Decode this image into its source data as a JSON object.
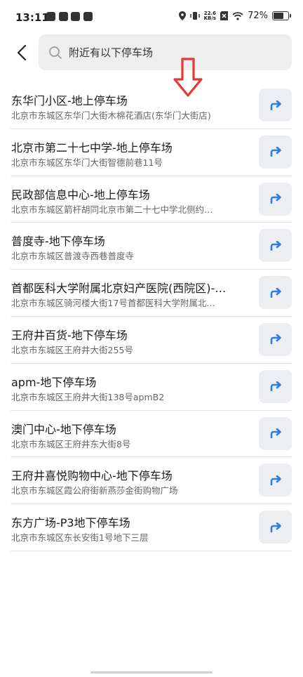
{
  "status_bar": {
    "time": "13:11",
    "net_speed_value": "22.6",
    "net_speed_unit": "KB/s",
    "battery_text": "72%",
    "battery_level": 0.72
  },
  "search": {
    "query": "附近有以下停车场"
  },
  "annotation": {
    "color": "#e53935"
  },
  "accent_color": "#2f7de1",
  "results": [
    {
      "title": "东华门小区-地上停车场",
      "address": "北京市东城区东华门大街木棉花酒店(东华门大街店)"
    },
    {
      "title": "北京市第二十七中学-地上停车场",
      "address": "北京市东城区东华门大街智德前巷11号"
    },
    {
      "title": "民政部信息中心-地上停车场",
      "address": "北京市东城区箭杆胡同北京市第二十七中学北侧约…"
    },
    {
      "title": "普度寺-地下停车场",
      "address": "北京市东城区普渡寺西巷普度寺"
    },
    {
      "title": "首都医科大学附属北京妇产医院(西院区)-…",
      "address": "北京市东城区骑河楼大街17号首都医科大学附属北…"
    },
    {
      "title": "王府井百货-地下停车场",
      "address": "北京市东城区王府井大街255号"
    },
    {
      "title": "apm-地下停车场",
      "address": "北京市东城区王府井大街138号apmB2"
    },
    {
      "title": "澳门中心-地下停车场",
      "address": "北京市东城区王府井东大街8号"
    },
    {
      "title": "王府井喜悦购物中心-地下停车场",
      "address": "北京市东城区霞公府街新燕莎金街购物广场"
    },
    {
      "title": "东方广场-P3地下停车场",
      "address": "北京市东城区东长安街1号地下三层"
    }
  ]
}
